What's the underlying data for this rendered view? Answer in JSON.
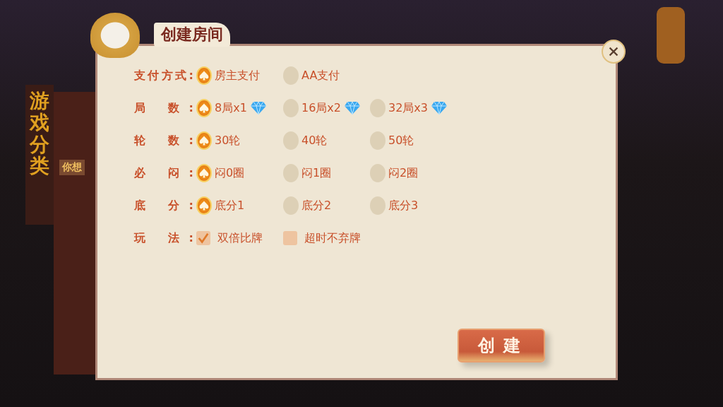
{
  "background": {
    "category_sign": "游戏分类",
    "side_label": "你想"
  },
  "dialog": {
    "title": "创建房间",
    "rows": [
      {
        "label": "支付方式:",
        "kind": "radio",
        "options": [
          {
            "text": "房主支付",
            "selected": true
          },
          {
            "text": "AA支付",
            "selected": false
          }
        ]
      },
      {
        "label": "局 数:",
        "kind": "radio",
        "options": [
          {
            "text": "8局x1",
            "selected": true,
            "diamond": true
          },
          {
            "text": "16局x2",
            "selected": false,
            "diamond": true
          },
          {
            "text": "32局x3",
            "selected": false,
            "diamond": true
          }
        ]
      },
      {
        "label": "轮 数:",
        "kind": "radio",
        "options": [
          {
            "text": "30轮",
            "selected": true
          },
          {
            "text": "40轮",
            "selected": false
          },
          {
            "text": "50轮",
            "selected": false
          }
        ]
      },
      {
        "label": "必 闷:",
        "kind": "radio",
        "options": [
          {
            "text": "闷0圈",
            "selected": true
          },
          {
            "text": "闷1圈",
            "selected": false
          },
          {
            "text": "闷2圈",
            "selected": false
          }
        ]
      },
      {
        "label": "底 分:",
        "kind": "radio",
        "options": [
          {
            "text": "底分1",
            "selected": true
          },
          {
            "text": "底分2",
            "selected": false
          },
          {
            "text": "底分3",
            "selected": false
          }
        ]
      },
      {
        "label": "玩 法:",
        "kind": "checkbox",
        "options": [
          {
            "text": "双倍比牌",
            "checked": true
          },
          {
            "text": "超时不弃牌",
            "checked": false
          }
        ]
      }
    ],
    "create_button": "创建"
  }
}
